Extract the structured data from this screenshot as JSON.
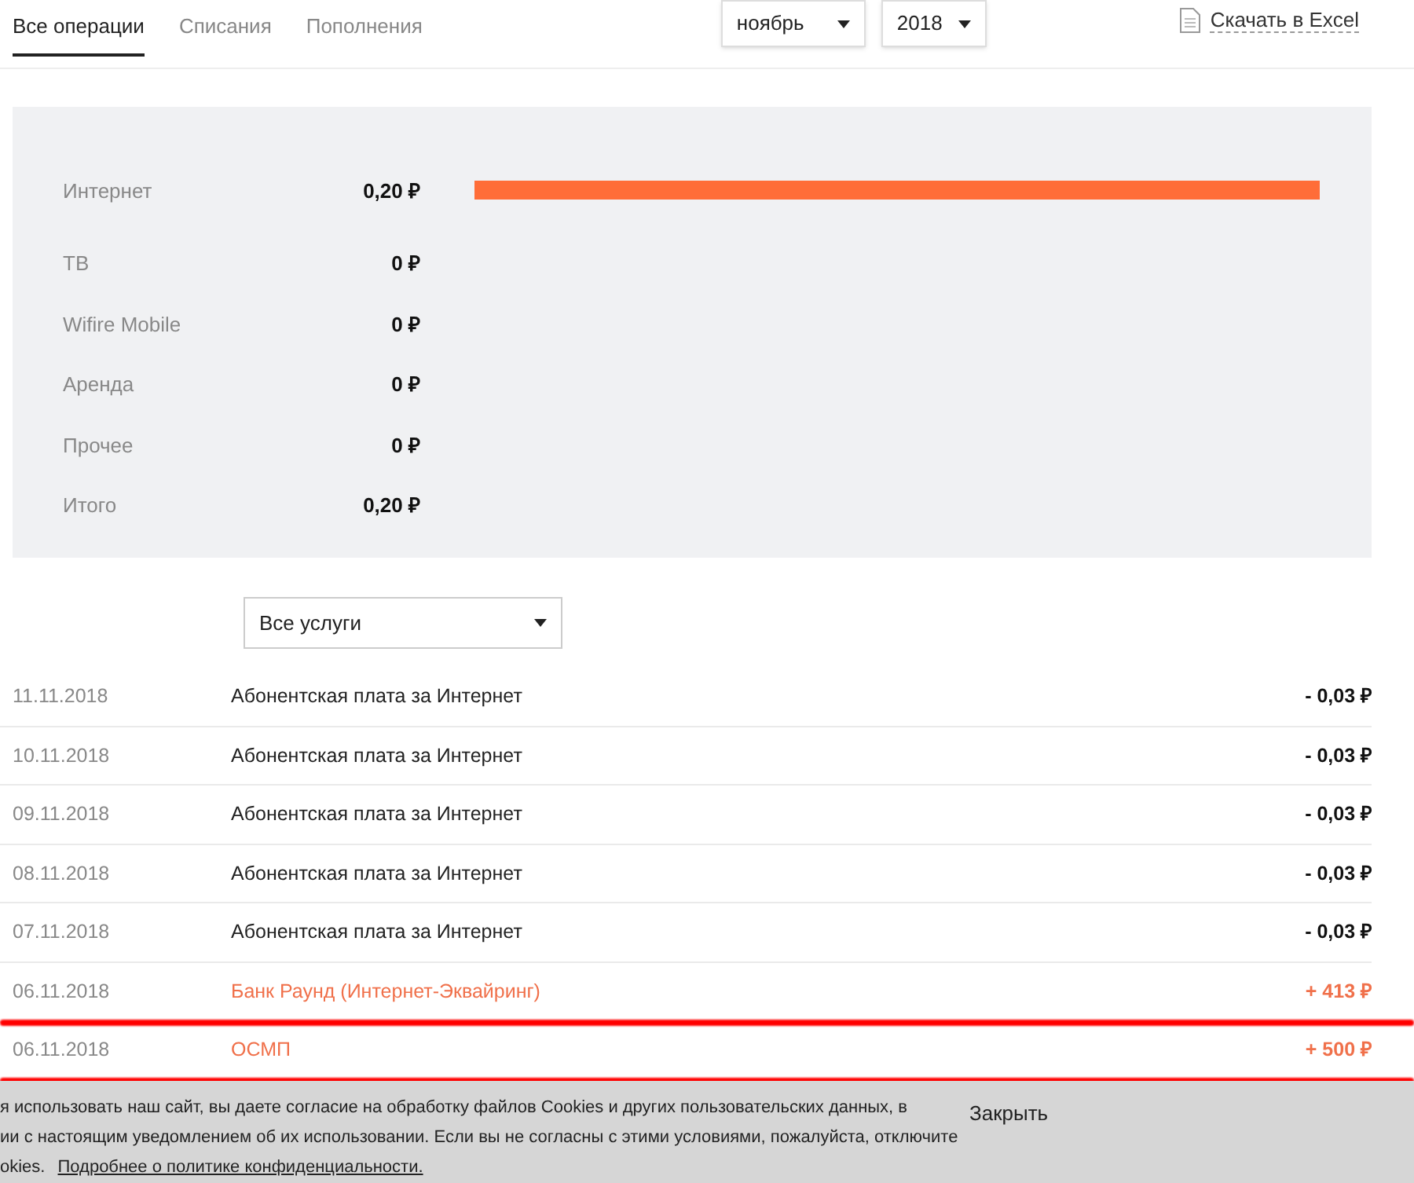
{
  "tabs": [
    {
      "label": "Все операции",
      "selected": true
    },
    {
      "label": "Списания",
      "selected": false
    },
    {
      "label": "Пополнения",
      "selected": false
    }
  ],
  "period": {
    "month": "ноябрь",
    "year": "2018"
  },
  "download_link": "Скачать в Excel",
  "summary": {
    "services": [
      {
        "name": "Интернет",
        "amount": "0,20 ₽",
        "level": 1
      },
      {
        "name": "ТВ",
        "amount": "0 ₽"
      },
      {
        "name": "Wifire Mobile",
        "amount": "0 ₽"
      },
      {
        "name": "Аренда",
        "amount": "0 ₽"
      },
      {
        "name": "Прочее",
        "amount": "0 ₽"
      }
    ],
    "total": {
      "name": "Итого",
      "amount": "0,20 ₽"
    }
  },
  "filter": {
    "value": "Все услуги"
  },
  "transactions": [
    {
      "date": "11.11.2018",
      "description": "Абонентская плата за Интернет",
      "amount": "- 0,03 ₽",
      "kind": "debit",
      "underlined": false
    },
    {
      "date": "10.11.2018",
      "description": "Абонентская плата за Интернет",
      "amount": "- 0,03 ₽",
      "kind": "debit",
      "underlined": false
    },
    {
      "date": "09.11.2018",
      "description": "Абонентская плата за Интернет",
      "amount": "- 0,03 ₽",
      "kind": "debit",
      "underlined": false
    },
    {
      "date": "08.11.2018",
      "description": "Абонентская плата за Интернет",
      "amount": "- 0,03 ₽",
      "kind": "debit",
      "underlined": false
    },
    {
      "date": "07.11.2018",
      "description": "Абонентская плата за Интернет",
      "amount": "- 0,03 ₽",
      "kind": "debit",
      "underlined": false
    },
    {
      "date": "06.11.2018",
      "description": "Банк Раунд (Интернет-Эквайринг)",
      "amount": "+ 413 ₽",
      "kind": "credit",
      "underlined": true
    },
    {
      "date": "06.11.2018",
      "description": "ОСМП",
      "amount": "+ 500 ₽",
      "kind": "credit",
      "underlined": true
    }
  ],
  "cookie_banner": {
    "lines": [
      "я использовать наш сайт, вы даете согласие на обработку файлов Cookies и других пользовательских данных, в",
      "ии с настоящим уведомлением об их использовании. Если вы не согласны с этими условиями, пожалуйста, отключите",
      "okies."
    ],
    "link": "Подробнее о политике конфиденциальности.",
    "close": "Закрыть"
  }
}
